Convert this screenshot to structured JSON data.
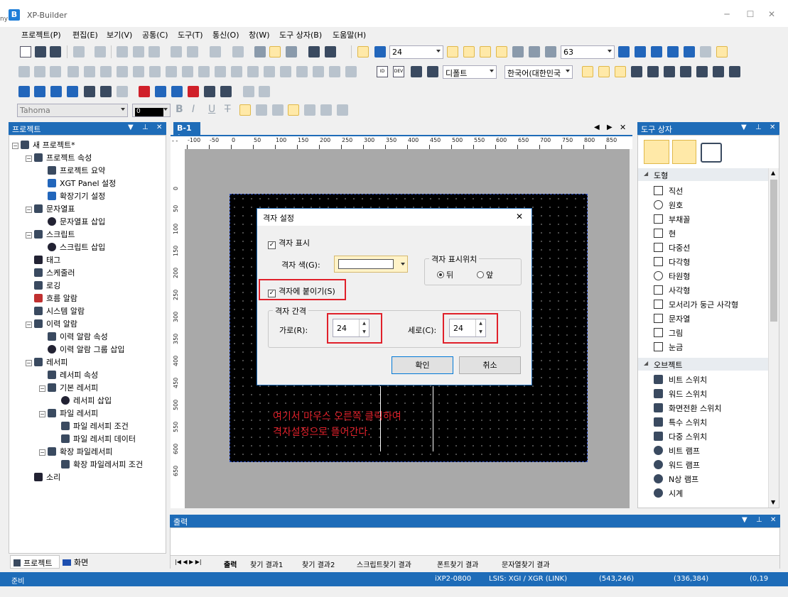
{
  "window": {
    "title": "XP-Builder",
    "edge_text": "ny",
    "min": "─",
    "max": "☐",
    "close": "✕"
  },
  "menu": [
    "프로젝트(P)",
    "편집(E)",
    "보기(V)",
    "공통(C)",
    "도구(T)",
    "통신(O)",
    "창(W)",
    "도구 상자(B)",
    "도움말(H)"
  ],
  "toolbar": {
    "grid_size": "24",
    "zoom": "63",
    "screen_style": "디폴트",
    "language": "한국어(대한민국",
    "font": "Tahoma",
    "color_value": "0",
    "font_btns": {
      "bold": "B",
      "italic": "I",
      "underline": "U",
      "strike": "T"
    }
  },
  "project_panel": {
    "title": "프로젝트",
    "tree": [
      {
        "label": "새 프로젝트*",
        "level": 0,
        "expand": "-",
        "icon": "doc"
      },
      {
        "label": "프로젝트 속성",
        "level": 1,
        "expand": "-",
        "icon": "tree"
      },
      {
        "label": "프로젝트 요약",
        "level": 2,
        "expand": "",
        "icon": "gear"
      },
      {
        "label": "XGT Panel 설정",
        "level": 2,
        "expand": "",
        "icon": "panel"
      },
      {
        "label": "확장기기 설정",
        "level": 2,
        "expand": "",
        "icon": "panel"
      },
      {
        "label": "문자열표",
        "level": 1,
        "expand": "-",
        "icon": "table"
      },
      {
        "label": "문자열표 삽입",
        "level": 2,
        "expand": "",
        "icon": "plus"
      },
      {
        "label": "스크립트",
        "level": 1,
        "expand": "-",
        "icon": "script"
      },
      {
        "label": "스크립트 삽입",
        "level": 2,
        "expand": "",
        "icon": "plus"
      },
      {
        "label": "태그",
        "level": 1,
        "expand": "",
        "icon": "tag"
      },
      {
        "label": "스케줄러",
        "level": 1,
        "expand": "",
        "icon": "cal"
      },
      {
        "label": "로깅",
        "level": 1,
        "expand": "",
        "icon": "log"
      },
      {
        "label": "흐름 알람",
        "level": 1,
        "expand": "",
        "icon": "alarm"
      },
      {
        "label": "시스템 알람",
        "level": 1,
        "expand": "",
        "icon": "alarm2"
      },
      {
        "label": "이력 알람",
        "level": 1,
        "expand": "-",
        "icon": "list"
      },
      {
        "label": "이력 알람 속성",
        "level": 2,
        "expand": "",
        "icon": "gear"
      },
      {
        "label": "이력 알람 그룹 삽입",
        "level": 2,
        "expand": "",
        "icon": "plus"
      },
      {
        "label": "레서피",
        "level": 1,
        "expand": "-",
        "icon": "flask"
      },
      {
        "label": "레서피 속성",
        "level": 2,
        "expand": "",
        "icon": "gear"
      },
      {
        "label": "기본 레서피",
        "level": 2,
        "expand": "-",
        "icon": "flask"
      },
      {
        "label": "레서피 삽입",
        "level": 3,
        "expand": "",
        "icon": "plus"
      },
      {
        "label": "파일 레서피",
        "level": 2,
        "expand": "-",
        "icon": "file"
      },
      {
        "label": "파일 레서피 조건",
        "level": 3,
        "expand": "",
        "icon": "file"
      },
      {
        "label": "파일 레서피 데이터",
        "level": 3,
        "expand": "",
        "icon": "file"
      },
      {
        "label": "확장 파일레서피",
        "level": 2,
        "expand": "-",
        "icon": "file"
      },
      {
        "label": "확장 파일레서피 조건",
        "level": 3,
        "expand": "",
        "icon": "file"
      },
      {
        "label": "소리",
        "level": 1,
        "expand": "",
        "icon": "note"
      }
    ],
    "tabs": [
      "프로젝트",
      "화면"
    ]
  },
  "editor": {
    "tab": "B-1 *",
    "ruler_h": [
      "-100",
      "-50",
      "0",
      "50",
      "100",
      "150",
      "200",
      "250",
      "300",
      "350",
      "400",
      "450",
      "500",
      "550",
      "600",
      "650",
      "700",
      "750",
      "800",
      "850"
    ],
    "ruler_v": [
      "0",
      "50",
      "100",
      "150",
      "200",
      "250",
      "300",
      "350",
      "400",
      "450",
      "500",
      "550",
      "600",
      "650"
    ],
    "annotation": [
      "여기서 마우스 오른쪽 클릭하여",
      "격자설정으로 들어간다."
    ]
  },
  "dialog": {
    "title": "격자 설정",
    "show_grid": "격자 표시",
    "grid_color_label": "격자 색(G):",
    "position_group": "격자 표시위치",
    "pos_back": "뒤",
    "pos_front": "앞",
    "snap": "격자에 붙이기(S)",
    "spacing_group": "격자 간격",
    "horizontal_label": "가로(R):",
    "horizontal_value": "24",
    "vertical_label": "세로(C):",
    "vertical_value": "24",
    "ok": "확인",
    "cancel": "취소"
  },
  "toolbox": {
    "title": "도구 상자",
    "shapes_header": "도형",
    "shapes": [
      "직선",
      "원호",
      "부채꼴",
      "현",
      "다중선",
      "다각형",
      "타원형",
      "사각형",
      "모서리가 둥근 사각형",
      "문자열",
      "그림",
      "눈금"
    ],
    "objects_header": "오브젝트",
    "objects": [
      "비트 스위치",
      "워드 스위치",
      "화면전환 스위치",
      "특수 스위치",
      "다중 스위치",
      "비트 램프",
      "워드 램프",
      "N상 램프",
      "시계"
    ]
  },
  "output": {
    "title": "출력",
    "tabs": [
      "출력",
      "찾기 결과1",
      "찾기 결과2",
      "스크립트찾기 결과",
      "폰트찾기 결과",
      "문자열찾기 결과"
    ]
  },
  "status": {
    "ready": "준비",
    "device": "iXP2-0800",
    "link": "LSIS: XGI / XGR (LINK)",
    "coord1": "(543,246)",
    "coord2": "(336,384)",
    "coord3": "(0,19"
  },
  "colors": {
    "accent": "#1e6cb8",
    "highlight": "#e0202a",
    "canvas": "#000000"
  }
}
